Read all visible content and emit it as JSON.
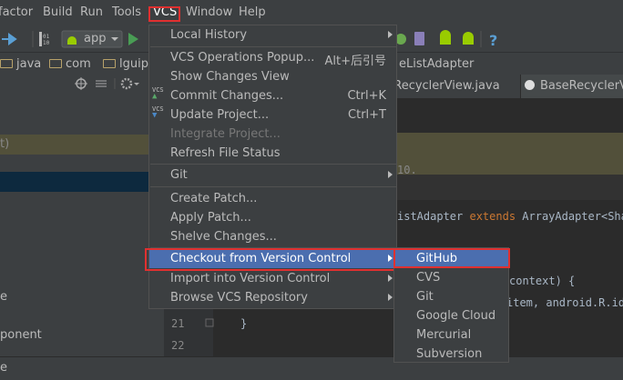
{
  "menubar": {
    "items": [
      "factor",
      "Build",
      "Run",
      "Tools",
      "VCS",
      "Window",
      "Help"
    ]
  },
  "toolbar": {
    "run_config": "app"
  },
  "breadcrumb": {
    "items": [
      "java",
      "com",
      "lguipe"
    ],
    "class_crumb": "eListAdapter"
  },
  "editor": {
    "tabs": [
      "dRecyclerView.java",
      "BaseRecyclerView"
    ],
    "line_numbers": [
      "21",
      "22"
    ],
    "code_lines": {
      "folded": "10.",
      "class_prefix": "istAdapter ",
      "class_extends": "extends",
      "class_suffix": " ArrayAdapter<Shar",
      "ctor_line": "context) {",
      "item_line": "item, android.R.id",
      "brace": "}"
    }
  },
  "left_panel": {
    "rows": [
      "t)",
      "e",
      "ponent"
    ]
  },
  "statusbar": {
    "left_text": "e"
  },
  "vcs_menu": {
    "items": [
      {
        "label": "Local History",
        "arrow": true
      },
      {
        "label": "VCS Operations Popup...",
        "shortcut": "Alt+后引号"
      },
      {
        "label": "Show Changes View"
      },
      {
        "label": "Commit Changes...",
        "shortcut": "Ctrl+K"
      },
      {
        "label": "Update Project...",
        "shortcut": "Ctrl+T"
      },
      {
        "label": "Integrate Project...",
        "disabled": true
      },
      {
        "label": "Refresh File Status"
      },
      {
        "label": "Git",
        "arrow": true
      },
      {
        "label": "Create Patch..."
      },
      {
        "label": "Apply Patch..."
      },
      {
        "label": "Shelve Changes..."
      },
      {
        "label": "Checkout from Version Control",
        "arrow": true,
        "highlighted": true
      },
      {
        "label": "Import into Version Control",
        "arrow": true
      },
      {
        "label": "Browse VCS Repository",
        "arrow": true
      }
    ],
    "vcs_icon_text": "VCS"
  },
  "checkout_submenu": {
    "items": [
      "GitHub",
      "CVS",
      "Git",
      "Google Cloud",
      "Mercurial",
      "Subversion"
    ],
    "highlighted": "GitHub"
  },
  "colors": {
    "highlight": "#4b6eaf",
    "annotation_box": "#e03030",
    "menu_bg": "#3c3f41"
  }
}
